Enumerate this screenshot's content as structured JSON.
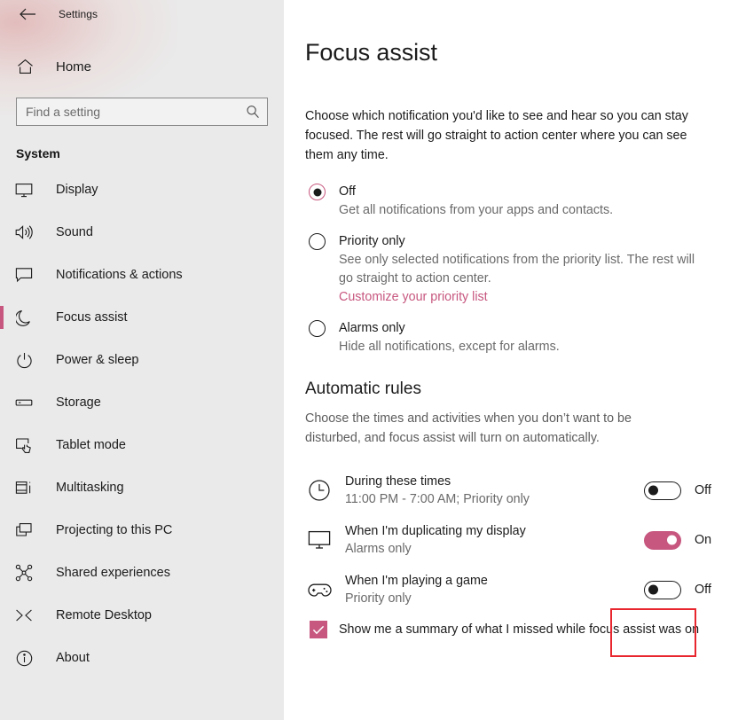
{
  "window": {
    "title": "Settings",
    "back_icon": "back-arrow-icon"
  },
  "sidebar": {
    "home": {
      "label": "Home",
      "icon": "home-icon"
    },
    "search": {
      "placeholder": "Find a setting",
      "value": "",
      "icon": "search-icon"
    },
    "section_header": "System",
    "accent_color": "#c7577f",
    "items": [
      {
        "label": "Display",
        "icon": "monitor-icon",
        "selected": false
      },
      {
        "label": "Sound",
        "icon": "speaker-icon",
        "selected": false
      },
      {
        "label": "Notifications & actions",
        "icon": "speech-bubble-icon",
        "selected": false
      },
      {
        "label": "Focus assist",
        "icon": "moon-icon",
        "selected": true
      },
      {
        "label": "Power & sleep",
        "icon": "power-icon",
        "selected": false
      },
      {
        "label": "Storage",
        "icon": "drive-icon",
        "selected": false
      },
      {
        "label": "Tablet mode",
        "icon": "tablet-hand-icon",
        "selected": false
      },
      {
        "label": "Multitasking",
        "icon": "multitasking-icon",
        "selected": false
      },
      {
        "label": "Projecting to this PC",
        "icon": "project-screen-icon",
        "selected": false
      },
      {
        "label": "Shared experiences",
        "icon": "share-nodes-icon",
        "selected": false
      },
      {
        "label": "Remote Desktop",
        "icon": "remote-desktop-icon",
        "selected": false
      },
      {
        "label": "About",
        "icon": "info-circle-icon",
        "selected": false
      }
    ]
  },
  "main": {
    "page_title": "Focus assist",
    "intro": "Choose which notification you'd like to see and hear so you can stay focused. The rest will go straight to action center where you can see them any time.",
    "options": [
      {
        "label": "Off",
        "description": "Get all notifications from your apps and contacts.",
        "selected": true
      },
      {
        "label": "Priority only",
        "description": "See only selected notifications from the priority list. The rest will go straight to action center.",
        "link": "Customize your priority list",
        "selected": false
      },
      {
        "label": "Alarms only",
        "description": "Hide all notifications, except for alarms.",
        "selected": false
      }
    ],
    "automatic_rules": {
      "heading": "Automatic rules",
      "description": "Choose the times and activities when you don’t want to be disturbed, and focus assist will turn on automatically.",
      "rules": [
        {
          "title": "During these times",
          "subtitle": "11:00 PM - 7:00 AM; Priority only",
          "icon": "clock-icon",
          "toggle_state": "Off",
          "on": false,
          "highlighted": false
        },
        {
          "title": "When I'm duplicating my display",
          "subtitle": "Alarms only",
          "icon": "monitor-icon",
          "toggle_state": "On",
          "on": true,
          "highlighted": false
        },
        {
          "title": "When I'm playing a game",
          "subtitle": "Priority only",
          "icon": "gamepad-icon",
          "toggle_state": "Off",
          "on": false,
          "highlighted": true
        }
      ]
    },
    "summary_checkbox": {
      "label": "Show me a summary of what I missed while focus assist was on",
      "checked": true
    }
  }
}
